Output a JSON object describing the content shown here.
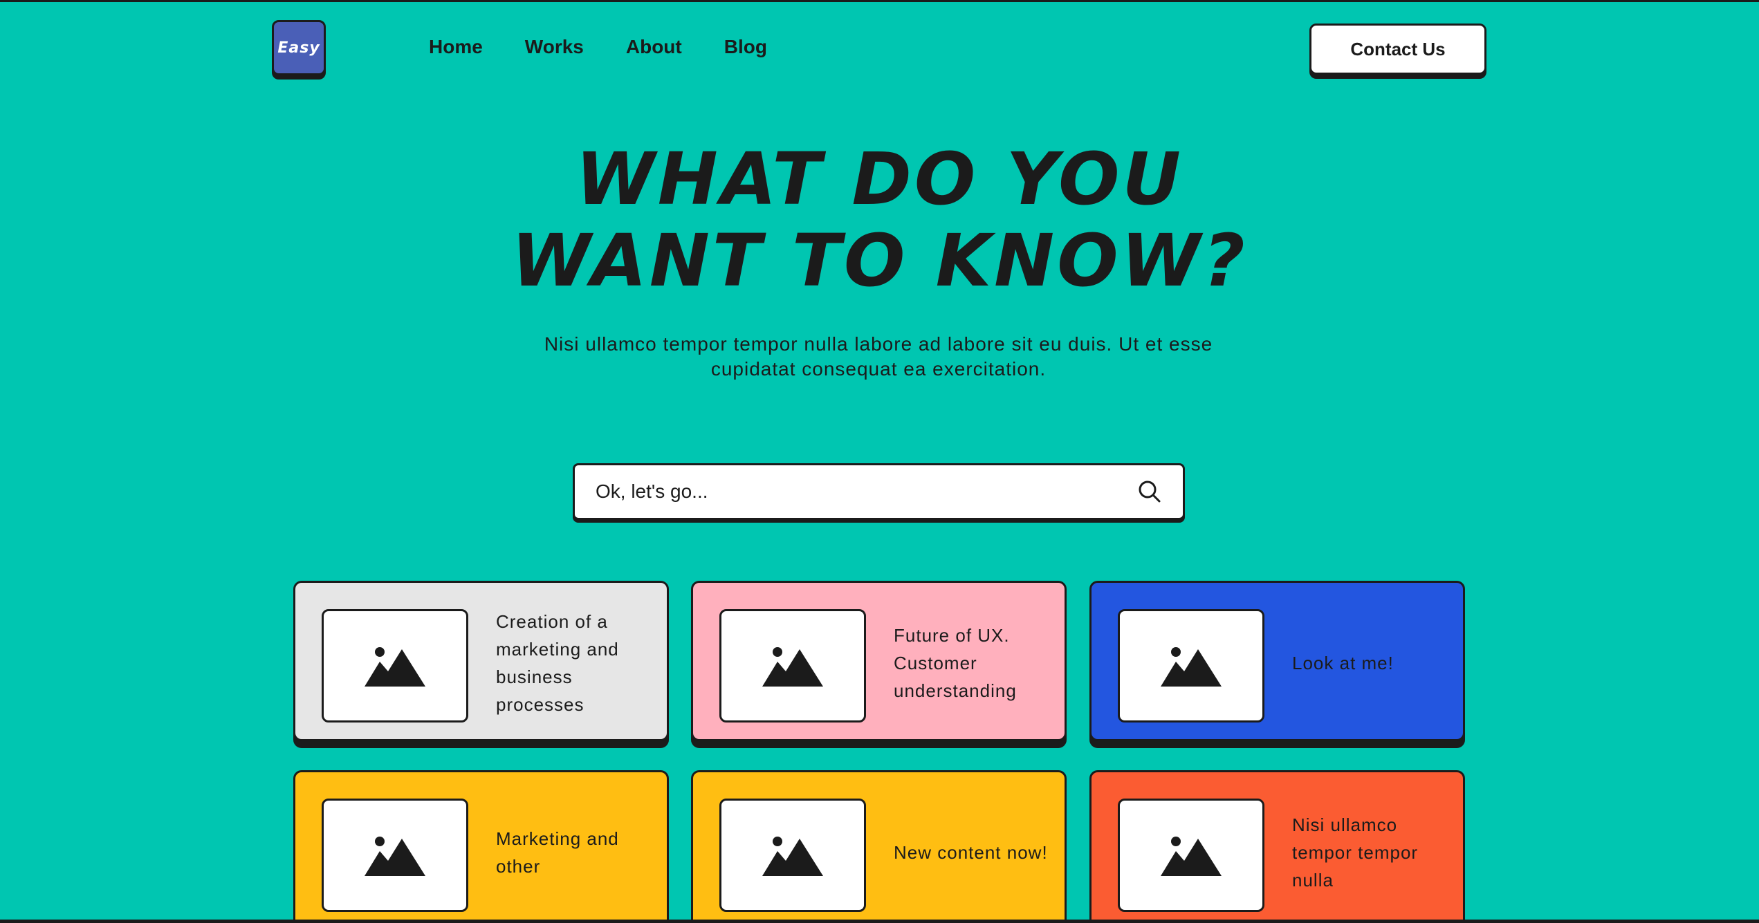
{
  "header": {
    "logo_text": "Easy",
    "nav": [
      "Home",
      "Works",
      "About",
      "Blog"
    ],
    "contact_label": "Contact Us"
  },
  "hero": {
    "title_line1": "What do you",
    "title_line2": "want to know?",
    "subtitle": "Nisi ullamco tempor tempor nulla labore ad labore sit eu duis. Ut et esse cupidatat consequat ea exercitation."
  },
  "search": {
    "placeholder": "Ok, let's go..."
  },
  "cards": [
    {
      "text": "Creation of a marketing and business processes",
      "color": "#e6e6e6"
    },
    {
      "text": "Future of UX. Customer understanding",
      "color": "#ffb0bd"
    },
    {
      "text": "Look at me!",
      "color": "#2356e0"
    },
    {
      "text": "Marketing and other",
      "color": "#ffbe12"
    },
    {
      "text": "New content now!",
      "color": "#ffbe12"
    },
    {
      "text": "Nisi ullamco tempor tempor nulla",
      "color": "#fb5c32"
    }
  ],
  "colors": {
    "background": "#00c6b1",
    "ink": "#1b1b1b",
    "logo": "#4a5fb7"
  }
}
